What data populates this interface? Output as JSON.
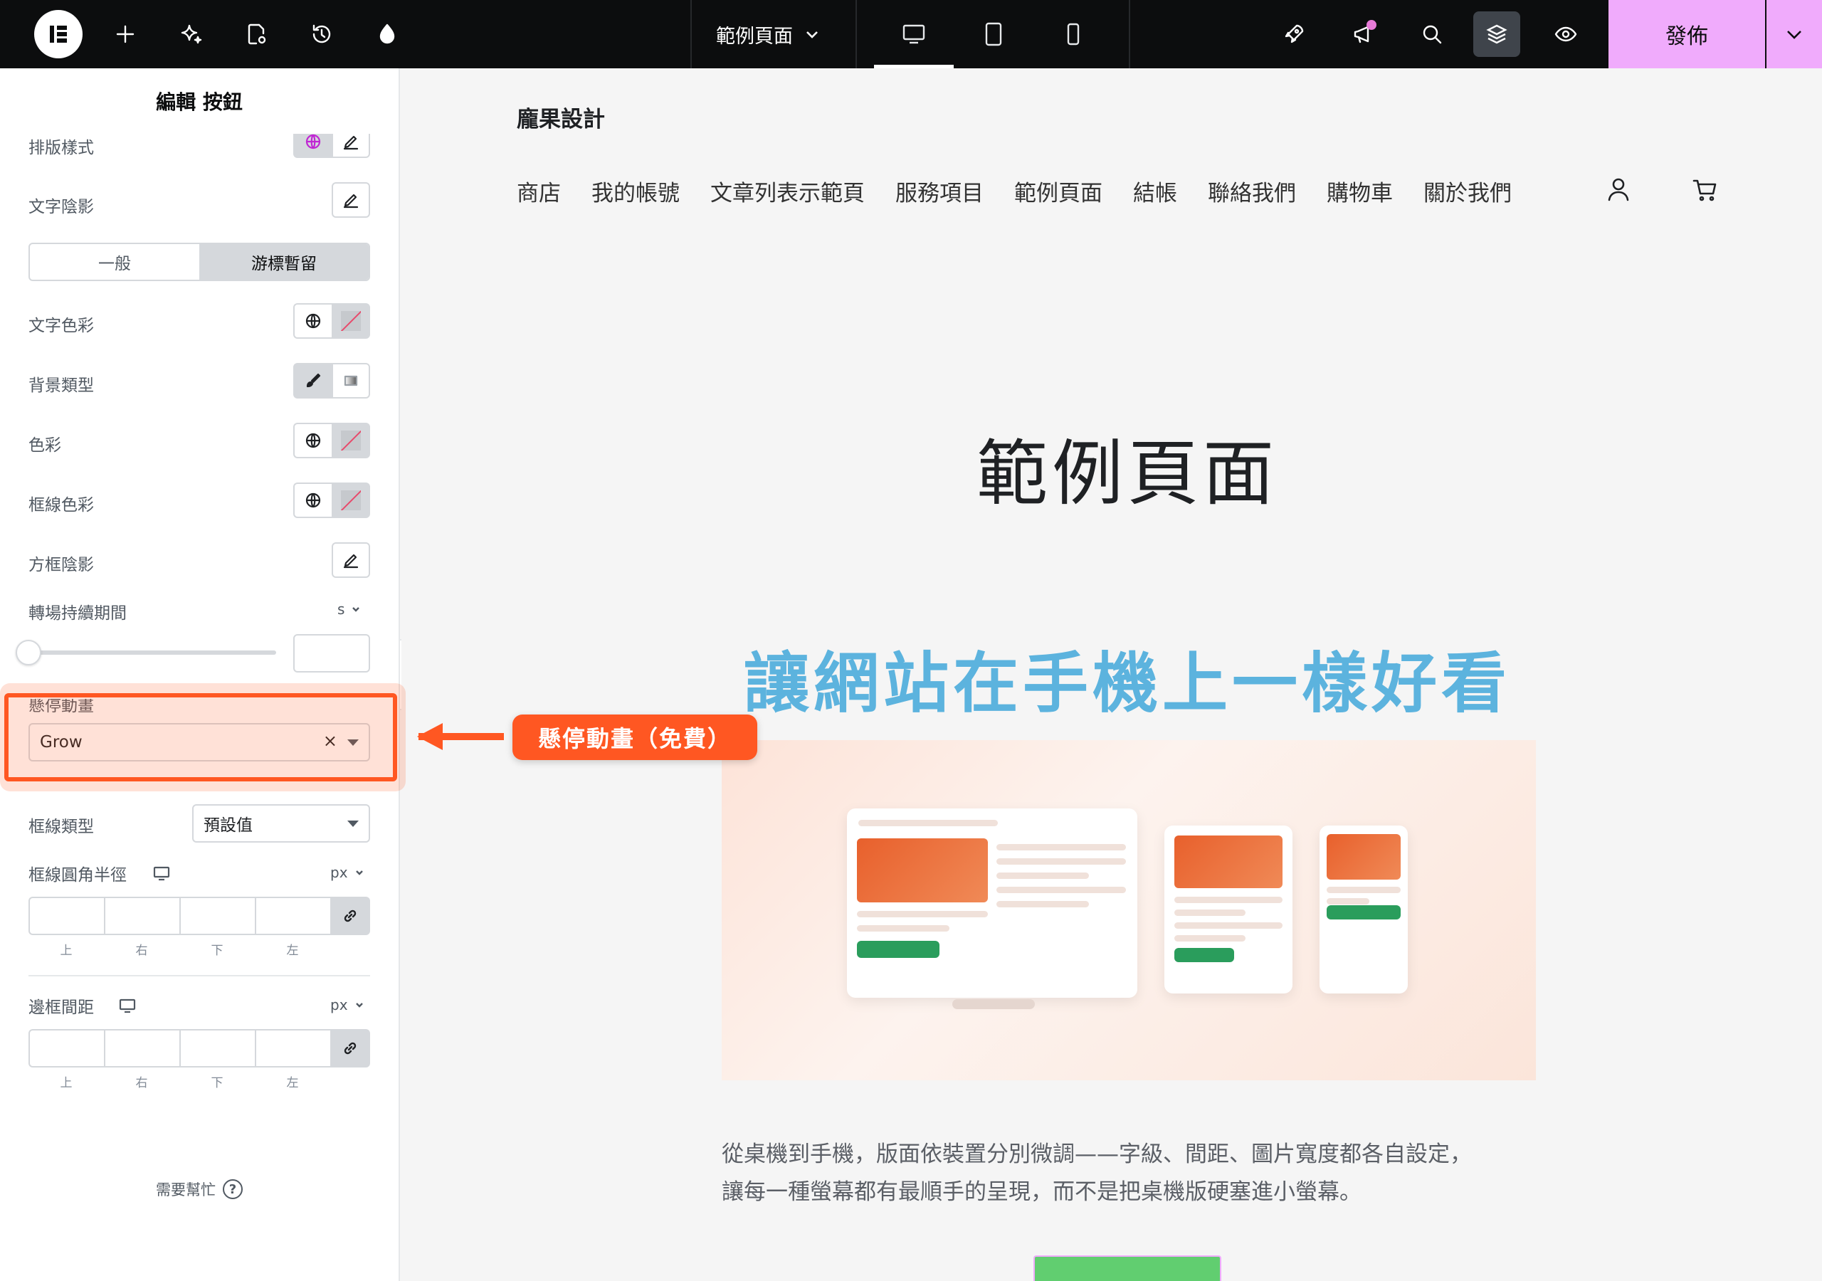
{
  "topbar": {
    "logo": "elementor-logo-icon",
    "page_selector": "範例頁面",
    "publish_label": "發佈",
    "icons": [
      "add-icon",
      "ai-sparkle-icon",
      "page-settings-icon",
      "history-icon",
      "theme-style-icon",
      "rocket-icon",
      "announcements-icon",
      "search-icon",
      "structure-icon",
      "preview-eye-icon"
    ]
  },
  "panel": {
    "title": "編輯 按鈕",
    "typography_label": "排版樣式",
    "text_shadow_label": "文字陰影",
    "tab_normal": "一般",
    "tab_hover": "游標暫留",
    "text_color_label": "文字色彩",
    "bg_type_label": "背景類型",
    "color_label": "色彩",
    "border_color_label": "框線色彩",
    "box_shadow_label": "方框陰影",
    "transition_label": "轉場持續期間",
    "transition_unit": "s",
    "hover_animation_label": "懸停動畫",
    "hover_animation_value": "Grow",
    "border_type_label": "框線類型",
    "border_type_value": "預設值",
    "border_radius_label": "框線圓角半徑",
    "border_radius_unit": "px",
    "padding_label": "邊框間距",
    "padding_unit": "px",
    "dim_top": "上",
    "dim_right": "右",
    "dim_bottom": "下",
    "dim_left": "左",
    "help_label": "需要幫忙",
    "help_icon": "?"
  },
  "callout": {
    "label": "懸停動畫（免費）",
    "color": "#ff5722"
  },
  "site": {
    "title": "龐果設計",
    "nav": [
      "商店",
      "我的帳號",
      "文章列表示範頁",
      "服務項目",
      "範例頁面",
      "結帳",
      "聯絡我們",
      "購物車",
      "關於我們"
    ],
    "hero_title": "範例頁面",
    "headline": "讓網站在手機上一樣好看",
    "paragraph_line1": "從桌機到手機，版面依裝置分別微調——字級、間距、圖片寬度都各自設定，",
    "paragraph_line2": "讓每一種螢幕都有最順手的呈現，而不是把桌機版硬塞進小螢幕。"
  },
  "colors": {
    "accent_publish": "#f0abfc",
    "headline_blue": "#5cb3de",
    "highlight_orange": "#ff5722"
  }
}
